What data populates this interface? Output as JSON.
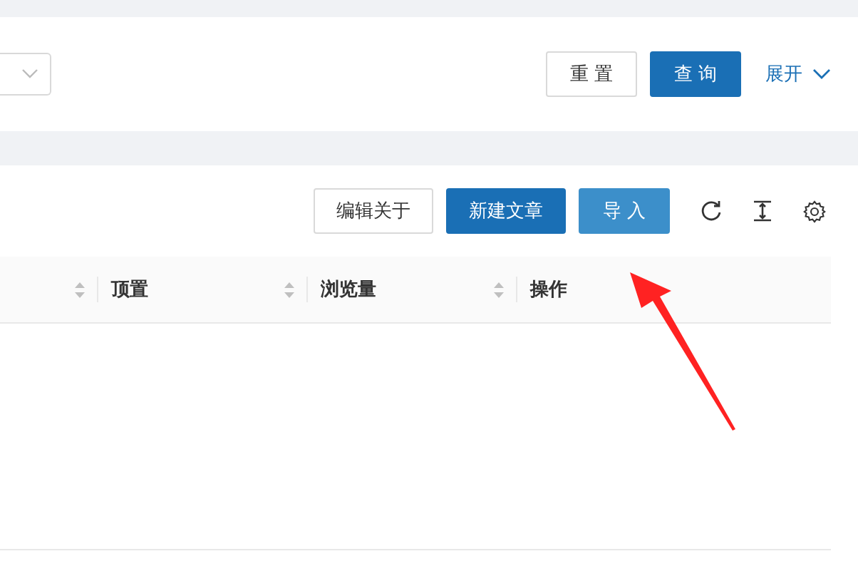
{
  "search_form": {
    "buttons": [
      {
        "label": "重 置",
        "kind": "default"
      },
      {
        "label": "查 询",
        "kind": "primary"
      }
    ],
    "expand_link": "展开"
  },
  "toolbar": {
    "buttons": [
      {
        "label": "编辑关于",
        "kind": "default"
      },
      {
        "label": "新建文章",
        "kind": "primary"
      },
      {
        "label": "导 入",
        "kind": "light"
      }
    ]
  },
  "table": {
    "columns": [
      {
        "sortable": true
      },
      {
        "label": "顶置",
        "sortable": true
      },
      {
        "label": "浏览量",
        "sortable": true
      },
      {
        "label": "操作",
        "sortable": false
      }
    ]
  }
}
